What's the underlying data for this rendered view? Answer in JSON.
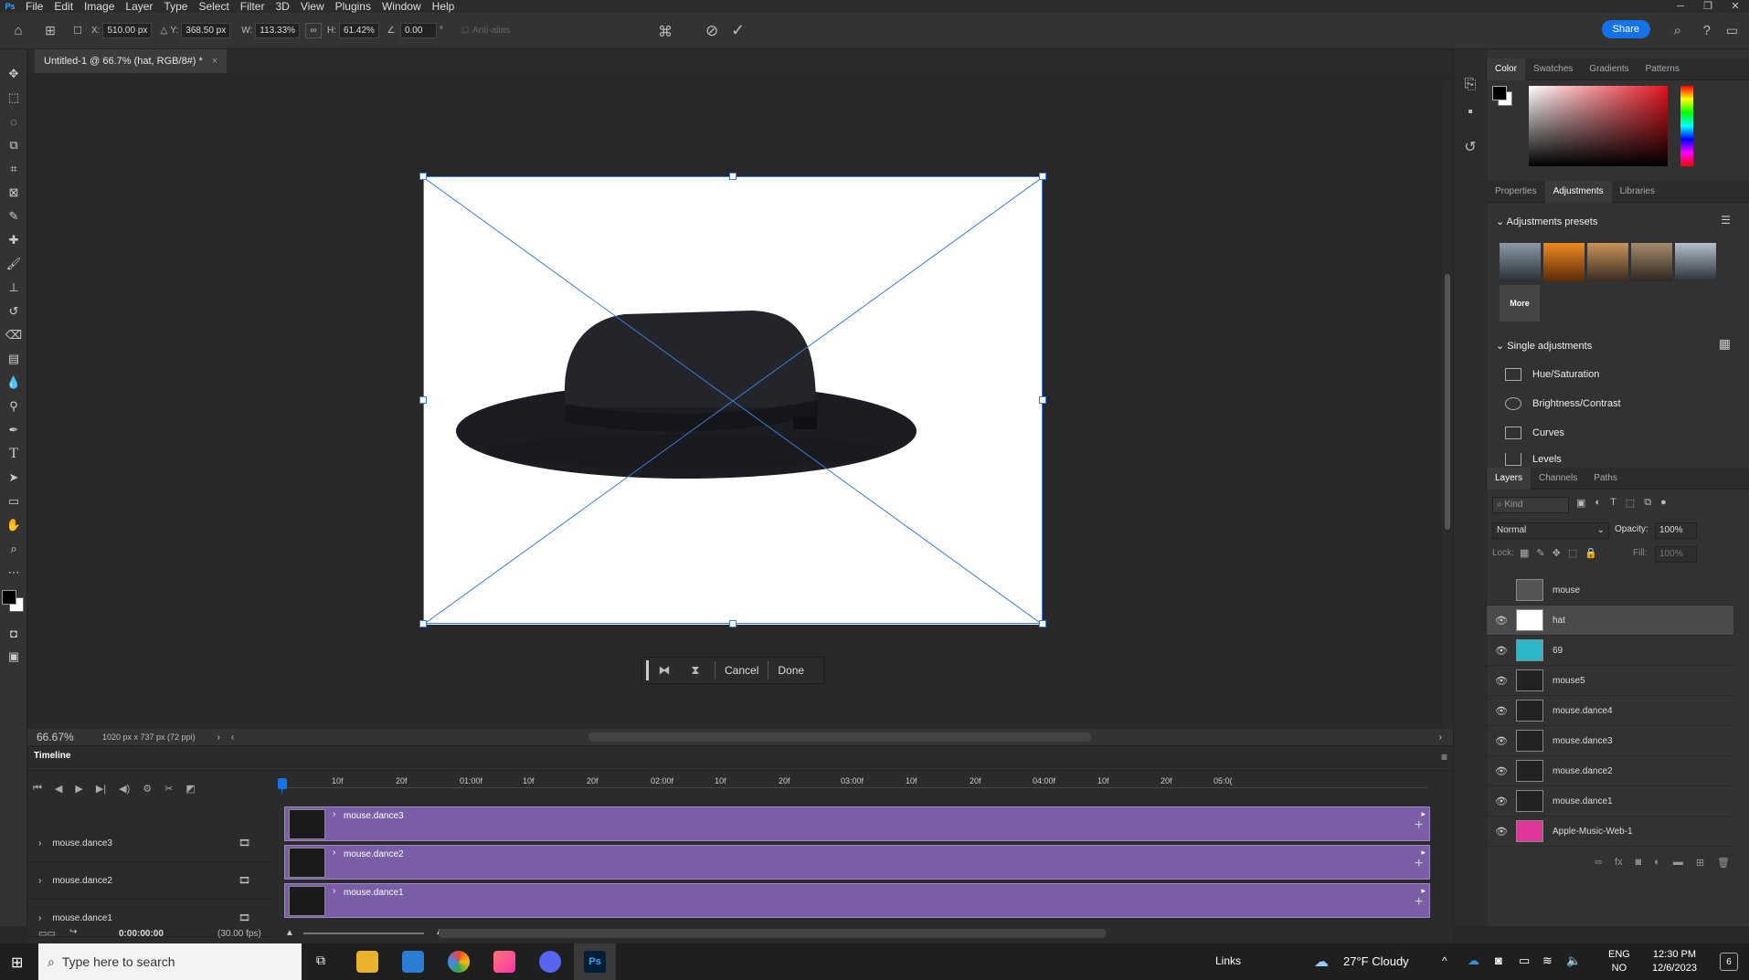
{
  "menu": [
    "File",
    "Edit",
    "Image",
    "Layer",
    "Type",
    "Select",
    "Filter",
    "3D",
    "View",
    "Plugins",
    "Window",
    "Help"
  ],
  "options": {
    "x_label": "X:",
    "x_value": "510.00 px",
    "y_label": "Y:",
    "y_value": "368.50 px",
    "w_label": "W:",
    "w_value": "113.33%",
    "h_label": "H:",
    "h_value": "61.42%",
    "angle_value": "0.00",
    "angle_unit": "°",
    "antialias_label": "Anti-alias",
    "share_label": "Share"
  },
  "document": {
    "tab_title": "Untitled-1 @ 66.7% (hat, RGB/8#) *",
    "zoom": "66.67%",
    "doc_info": "1020 px x 737 px (72 ppi)"
  },
  "context_bar": {
    "cancel": "Cancel",
    "done": "Done"
  },
  "timeline": {
    "title": "Timeline",
    "ruler": [
      "10f",
      "20f",
      "01:00f",
      "10f",
      "20f",
      "02:00f",
      "10f",
      "20f",
      "03:00f",
      "10f",
      "20f",
      "04:00f",
      "10f",
      "20f",
      "05:0("
    ],
    "tracks": [
      {
        "name": "mouse.dance3"
      },
      {
        "name": "mouse.dance2"
      },
      {
        "name": "mouse.dance1"
      }
    ],
    "clips": [
      {
        "name": "mouse.dance3"
      },
      {
        "name": "mouse.dance2"
      },
      {
        "name": "mouse.dance1"
      }
    ],
    "timecode": "0:00:00:00",
    "fps": "(30.00 fps)"
  },
  "panels": {
    "color_tabs": [
      "Color",
      "Swatches",
      "Gradients",
      "Patterns"
    ],
    "mid_tabs": [
      "Properties",
      "Adjustments",
      "Libraries"
    ],
    "adjustments_presets": "Adjustments presets",
    "more": "More",
    "single_adjustments": "Single adjustments",
    "adjustments": [
      "Hue/Saturation",
      "Brightness/Contrast",
      "Curves",
      "Levels"
    ],
    "layer_tabs": [
      "Layers",
      "Channels",
      "Paths"
    ],
    "kind_placeholder": "Kind",
    "blend_mode": "Normal",
    "opacity_label": "Opacity:",
    "opacity_value": "100%",
    "lock_label": "Lock:",
    "fill_label": "Fill:",
    "fill_value": "100%"
  },
  "layers": [
    {
      "name": "mouse",
      "visible": false,
      "selected": false
    },
    {
      "name": "hat",
      "visible": true,
      "selected": true
    },
    {
      "name": "69",
      "visible": true,
      "selected": false
    },
    {
      "name": "mouse5",
      "visible": true,
      "selected": false
    },
    {
      "name": "mouse.dance4",
      "visible": true,
      "selected": false
    },
    {
      "name": "mouse.dance3",
      "visible": true,
      "selected": false
    },
    {
      "name": "mouse.dance2",
      "visible": true,
      "selected": false
    },
    {
      "name": "mouse.dance1",
      "visible": true,
      "selected": false
    },
    {
      "name": "Apple-Music-Web-1",
      "visible": true,
      "selected": false
    }
  ],
  "taskbar": {
    "search_placeholder": "Type here to search",
    "links": "Links",
    "weather": "27°F  Cloudy",
    "lang1": "ENG",
    "lang2": "NO",
    "time": "12:30 PM",
    "date": "12/6/2023",
    "notif_count": "6"
  },
  "colors": {
    "accent": "#1473e6",
    "clip": "#7a5fa7",
    "selection": "#3d7bd6"
  }
}
